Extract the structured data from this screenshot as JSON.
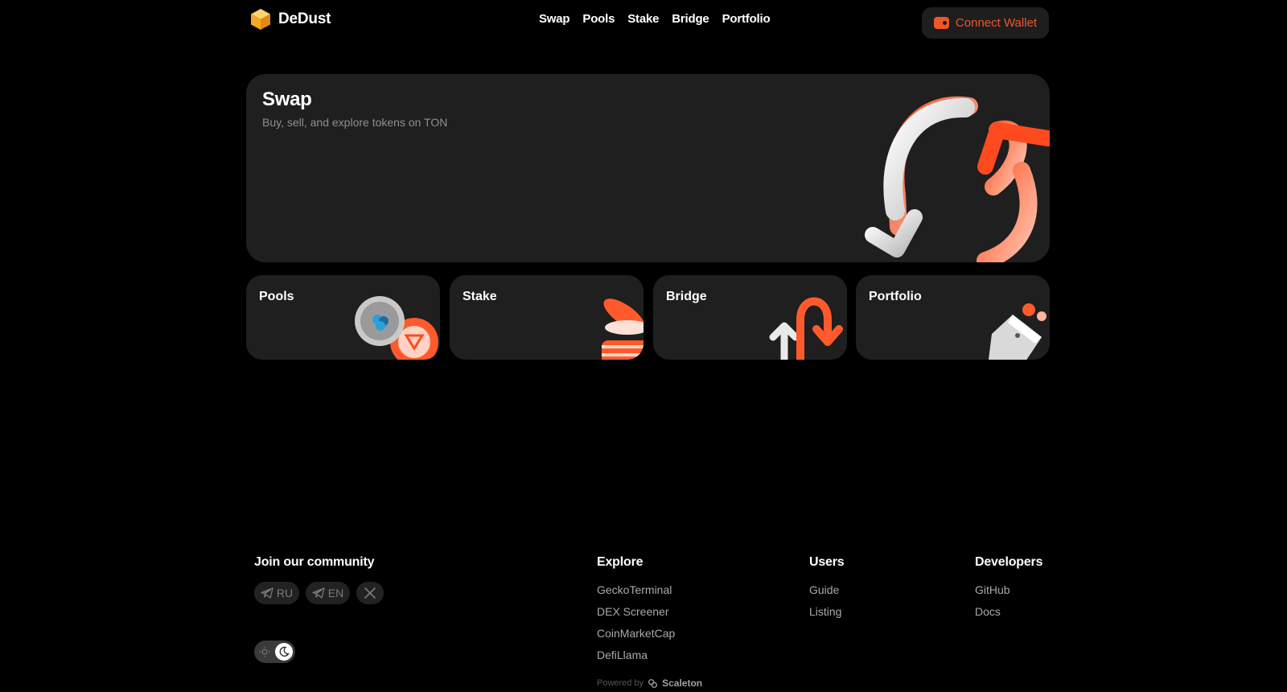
{
  "brand": {
    "name": "DeDust"
  },
  "nav": {
    "items": [
      "Swap",
      "Pools",
      "Stake",
      "Bridge",
      "Portfolio"
    ]
  },
  "header": {
    "connect_label": "Connect Wallet"
  },
  "hero": {
    "title": "Swap",
    "subtitle": "Buy, sell, and explore tokens on TON"
  },
  "cards": [
    {
      "title": "Pools"
    },
    {
      "title": "Stake"
    },
    {
      "title": "Bridge"
    },
    {
      "title": "Portfolio"
    }
  ],
  "footer": {
    "community_title": "Join our community",
    "chips": [
      "RU",
      "EN"
    ],
    "explore": {
      "title": "Explore",
      "links": [
        "GeckoTerminal",
        "DEX Screener",
        "CoinMarketCap",
        "DefiLlama"
      ]
    },
    "users": {
      "title": "Users",
      "links": [
        "Guide",
        "Listing"
      ]
    },
    "developers": {
      "title": "Developers",
      "links": [
        "GitHub",
        "Docs"
      ]
    },
    "powered_label": "Powered by",
    "powered_brand": "Scaleton"
  },
  "colors": {
    "accent": "#f0552b",
    "card": "#1f1f1f",
    "background": "#000000",
    "logo": "#f5b533"
  },
  "icons": [
    "cube-logo",
    "wallet-icon",
    "telegram-icon",
    "x-icon",
    "sun-icon",
    "moon-icon",
    "scaleton-icon"
  ]
}
